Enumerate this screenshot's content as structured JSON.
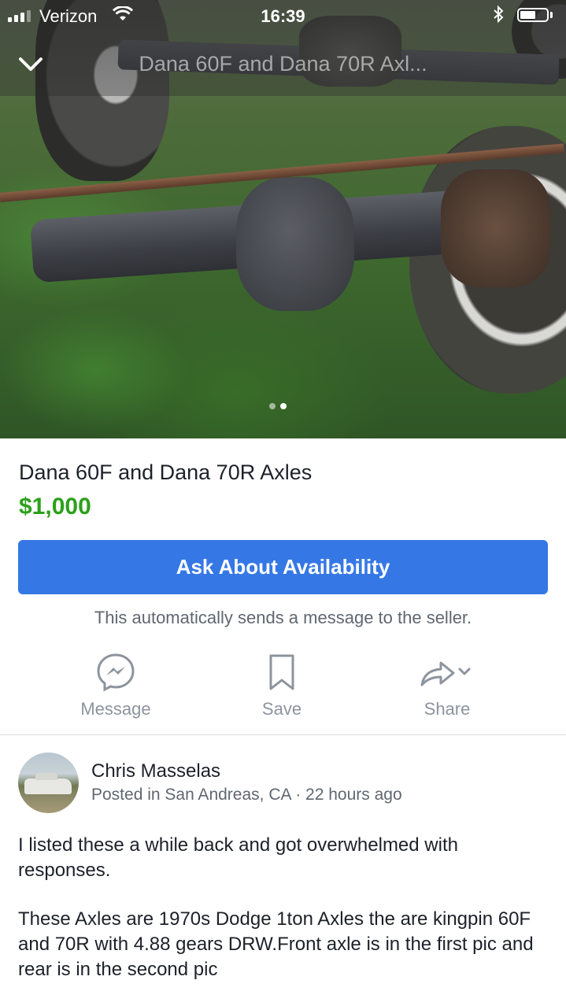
{
  "status_bar": {
    "carrier": "Verizon",
    "time": "16:39",
    "bluetooth_icon": "bluetooth-icon"
  },
  "nav": {
    "title": "Dana 60F and Dana 70R Axl...",
    "back_icon": "chevron-down-icon"
  },
  "gallery": {
    "image_count": 2,
    "current_index": 2
  },
  "listing": {
    "title": "Dana 60F and Dana 70R Axles",
    "price": "$1,000",
    "price_color": "#2ca01c"
  },
  "cta": {
    "label": "Ask About Availability",
    "color": "#3578e5",
    "note": "This automatically sends a message to the seller."
  },
  "actions": [
    {
      "label": "Message",
      "icon": "messenger-icon"
    },
    {
      "label": "Save",
      "icon": "bookmark-icon"
    },
    {
      "label": "Share",
      "icon": "share-icon"
    }
  ],
  "seller": {
    "name": "Chris Masselas",
    "location": "Posted in San Andreas, CA",
    "separator": "·",
    "time_ago": "22 hours ago"
  },
  "description": [
    "I listed these a while back and got overwhelmed with responses.",
    "These Axles are 1970s Dodge 1ton Axles the are kingpin 60F and 70R with 4.88 gears DRW.Front axle is in the first pic and rear is in the second pic"
  ]
}
